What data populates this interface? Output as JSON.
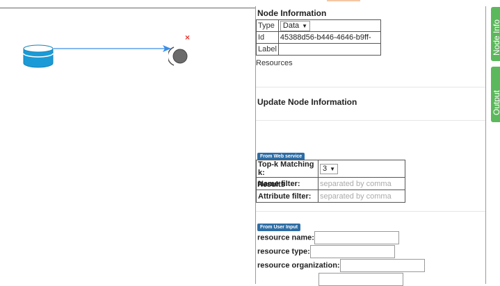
{
  "graph": {
    "nodes": [
      {
        "kind": "data",
        "icon": "database-icon"
      },
      {
        "kind": "output",
        "icon": "circle-node-icon",
        "remove_mark": "×"
      }
    ]
  },
  "node_info": {
    "title": "Node Information",
    "type_label": "Type",
    "type_value": "Data",
    "id_label": "Id",
    "id_value": "45388d56-b446-4646-b9ff-",
    "label_label": "Label",
    "label_value": "",
    "resources_label": "Resources"
  },
  "update": {
    "title": "Update Node Information"
  },
  "web_service": {
    "tag": "From Web service",
    "topk_label": "Top-k Matching k:",
    "topk_value": "3",
    "name_filter_label": "Name filter:",
    "name_filter_placeholder": "separated by comma",
    "attr_filter_label": "Attribute filter:",
    "attr_filter_placeholder": "separated by comma",
    "results_label": "Results"
  },
  "user_input": {
    "tag": "From User Input",
    "resource_name_label": "resource name:",
    "resource_type_label": "resource type:",
    "resource_org_label": "resource organization:"
  },
  "side_tabs": {
    "node_info": "Node Info",
    "output": "Output"
  },
  "colors": {
    "db_fill": "#1a9bd7",
    "edge": "#3a8ee6",
    "tab_green": "#5cb85c",
    "tag_blue": "#2e6da4",
    "remove_red": "#e53935"
  }
}
